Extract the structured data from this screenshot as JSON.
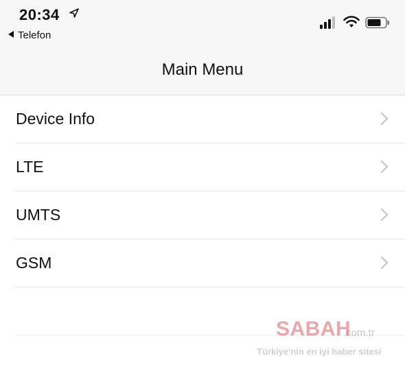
{
  "status_bar": {
    "time": "20:34",
    "back_app": "Telefon",
    "icons": [
      "location-arrow-icon",
      "signal-icon",
      "wifi-icon",
      "battery-icon"
    ]
  },
  "nav": {
    "title": "Main Menu"
  },
  "menu": {
    "items": [
      {
        "label": "Device Info"
      },
      {
        "label": "LTE"
      },
      {
        "label": "UMTS"
      },
      {
        "label": "GSM"
      }
    ]
  },
  "watermark": {
    "logo": "SABAH",
    "domain": ".com.tr",
    "tagline": "Türkiye'nin en iyi haber sitesi"
  },
  "colors": {
    "bar_background": "#f7f7f7",
    "separator": "#e4e4e4",
    "chevron": "#c4c4c9",
    "watermark_red": "#c8232d"
  }
}
